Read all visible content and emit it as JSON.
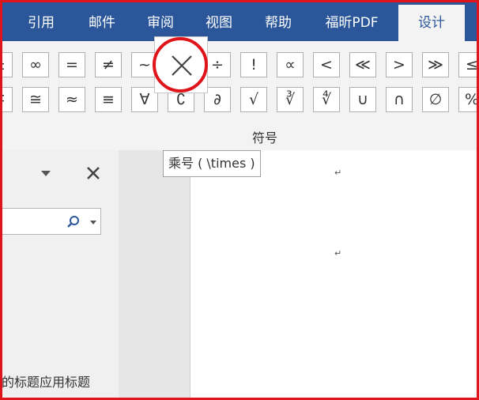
{
  "ribbon_tabs": {
    "references": "引用",
    "mailings": "邮件",
    "review": "审阅",
    "view": "视图",
    "help": "帮助",
    "foxit_pdf": "福昕PDF",
    "design": "设计"
  },
  "symbols": {
    "row1": [
      "±",
      "∞",
      "=",
      "≠",
      "~",
      "×",
      "÷",
      "!",
      "∝",
      "<",
      "≪",
      ">",
      "≫",
      "≤"
    ],
    "row2": [
      "∓",
      "≅",
      "≈",
      "≡",
      "∀",
      "∁",
      "∂",
      "√",
      "∛",
      "∜",
      "∪",
      "∩",
      "∅",
      "%"
    ]
  },
  "group_label": "符号",
  "tooltip": "乘号 ( \\times )",
  "nav_pane": {
    "heading_hint": "的标题应用标题"
  },
  "document": {
    "paragraph_mark": "↵"
  },
  "colors": {
    "ribbon_blue": "#2b579a",
    "highlight_red": "#e0141b"
  },
  "icons": [
    "times-icon",
    "close-icon",
    "dropdown-triangle-icon",
    "search-icon",
    "chevron-down-icon"
  ]
}
